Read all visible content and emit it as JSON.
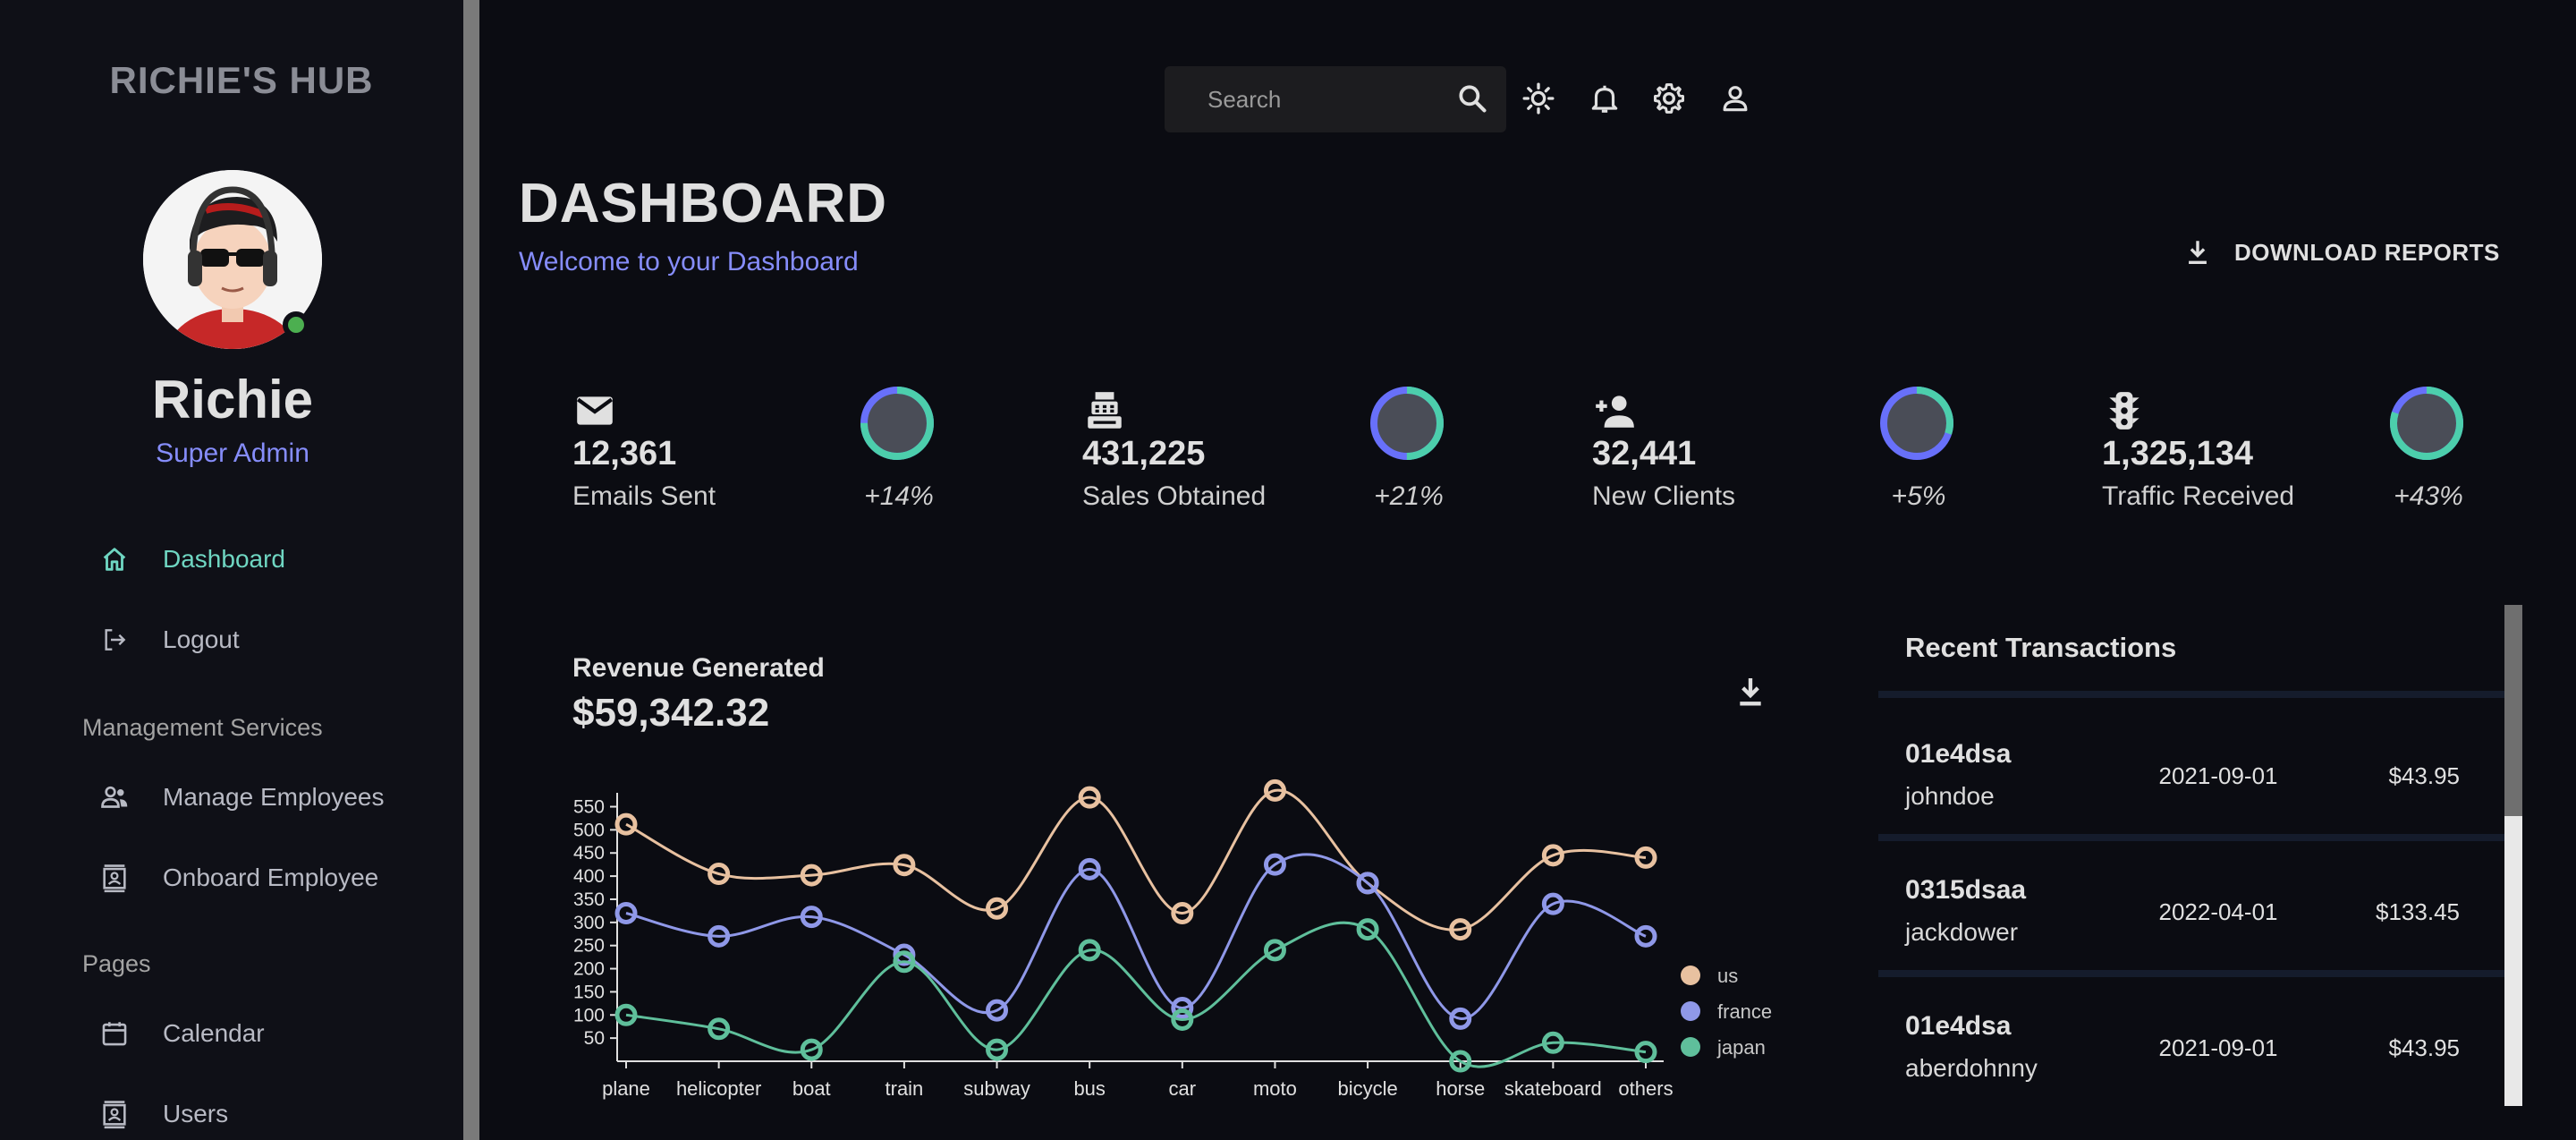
{
  "sidebar": {
    "brand": "RICHIE'S HUB",
    "user_name": "Richie",
    "user_role": "Super Admin",
    "items": [
      {
        "label": "Dashboard",
        "icon": "home-icon"
      },
      {
        "label": "Logout",
        "icon": "logout-icon"
      },
      {
        "label": "Manage Employees",
        "icon": "people-icon"
      },
      {
        "label": "Onboard Employee",
        "icon": "contact-card-icon"
      },
      {
        "label": "Calendar",
        "icon": "calendar-icon"
      },
      {
        "label": "Users",
        "icon": "contact-card-icon"
      }
    ],
    "sections": [
      "Management Services",
      "Pages"
    ]
  },
  "topbar": {
    "search_placeholder": "Search",
    "icons": [
      "search-icon",
      "sun-icon",
      "bell-icon",
      "gear-icon",
      "person-icon"
    ]
  },
  "header": {
    "title": "DASHBOARD",
    "subtitle": "Welcome to your Dashboard",
    "download_label": "DOWNLOAD REPORTS"
  },
  "stats": [
    {
      "value": "12,361",
      "label": "Emails Sent",
      "increase": "+14%",
      "progress": 0.75,
      "icon": "email-icon"
    },
    {
      "value": "431,225",
      "label": "Sales Obtained",
      "increase": "+21%",
      "progress": 0.5,
      "icon": "point-of-sale-icon"
    },
    {
      "value": "32,441",
      "label": "New Clients",
      "increase": "+5%",
      "progress": 0.3,
      "icon": "person-add-icon"
    },
    {
      "value": "1,325,134",
      "label": "Traffic Received",
      "increase": "+43%",
      "progress": 0.8,
      "icon": "traffic-icon"
    }
  ],
  "revenue": {
    "title": "Revenue Generated",
    "value": "$59,342.32"
  },
  "colors": {
    "accent_green": "#4cceac",
    "accent_blue": "#6870fa",
    "us": "#e8c1a0",
    "france": "#8f98e8",
    "japan": "#5fbf9b"
  },
  "chart_data": {
    "type": "line",
    "categories": [
      "plane",
      "helicopter",
      "boat",
      "train",
      "subway",
      "bus",
      "car",
      "moto",
      "bicycle",
      "horse",
      "skateboard",
      "others"
    ],
    "series": [
      {
        "name": "us",
        "values": [
          512,
          405,
          402,
          424,
          330,
          570,
          320,
          585,
          385,
          285,
          445,
          440
        ]
      },
      {
        "name": "france",
        "values": [
          320,
          270,
          312,
          230,
          110,
          415,
          115,
          425,
          385,
          92,
          340,
          270
        ]
      },
      {
        "name": "japan",
        "values": [
          100,
          70,
          25,
          215,
          25,
          240,
          90,
          240,
          285,
          0,
          40,
          20
        ]
      }
    ],
    "y_ticks": [
      50,
      100,
      150,
      200,
      250,
      300,
      350,
      400,
      450,
      500,
      550
    ],
    "ylim": [
      0,
      580
    ],
    "legend": "bottom-right"
  },
  "transactions": {
    "title": "Recent Transactions",
    "rows": [
      {
        "txId": "01e4dsa",
        "user": "johndoe",
        "date": "2021-09-01",
        "cost": "$43.95"
      },
      {
        "txId": "0315dsaa",
        "user": "jackdower",
        "date": "2022-04-01",
        "cost": "$133.45"
      },
      {
        "txId": "01e4dsa",
        "user": "aberdohnny",
        "date": "2021-09-01",
        "cost": "$43.95"
      }
    ]
  }
}
